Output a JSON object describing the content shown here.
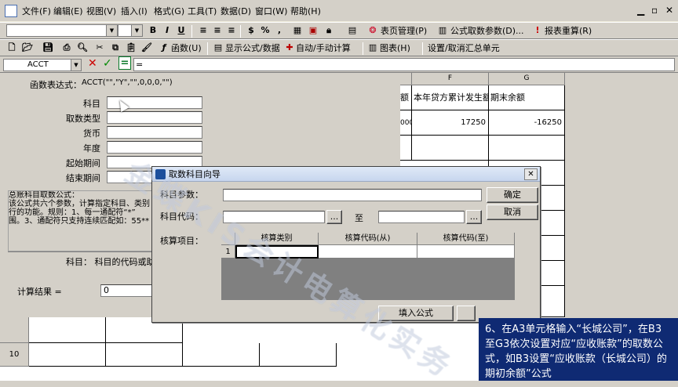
{
  "menu": {
    "items": [
      "文件(F)",
      "编辑(E)",
      "视图(V)",
      "插入(I)",
      "格式(G)",
      "工具(T)",
      "数据(D)",
      "窗口(W)",
      "帮助(H)"
    ],
    "window_controls": [
      "▁",
      "▫",
      "✕"
    ]
  },
  "toolbar1": {
    "font_name": "",
    "font_size": "",
    "bold": "B",
    "italic": "I",
    "underline": "U",
    "percent": "%",
    "comma": ",",
    "sheet_mgmt": "表页管理(P)",
    "fetch_params": "公式取数参数(D)...",
    "recalc": "报表重算(R)"
  },
  "toolbar2": {
    "func": "函数(U)",
    "show_formula": "显示公式/数据",
    "auto_calc": "自动/手动计算",
    "chart": "图表(H)",
    "set_cancel": "设置/取消汇总单元"
  },
  "formula_bar": {
    "name_box": "ACCT",
    "cancel": "✕",
    "confirm": "✓",
    "equals": "=",
    "content": "="
  },
  "spreadsheet": {
    "col_f": "F",
    "col_g": "G",
    "header_e_partial": "额",
    "header_f": "本年贷方累计发生额",
    "header_g": "期末余额",
    "val_e_partial": "000",
    "val_f": "17250",
    "val_g": "-16250",
    "row10": "10"
  },
  "func_panel": {
    "expr_label": "函数表达式：",
    "expr_value": "ACCT(\"\",\"Y\",\"\",0,0,0,\"\")",
    "labels": [
      "科目",
      "取数类型",
      "货币",
      "年度",
      "起始期间",
      "结束期间"
    ],
    "desc_lines": [
      "总账科目取数公式：",
      "该公式共六个参数，计算指定科目、类别",
      "行的功能。规则：1、每一通配符“*”",
      "围。3、通配符只支持连续匹配如：55**"
    ],
    "subject_hint": "科目：  科目的代码或助记",
    "result_label": "计算结果 =",
    "result_value": "0"
  },
  "dialog": {
    "title": "取数科目向导",
    "subject_param_label": "科目参数：",
    "subject_code_label": "科目代码：",
    "to_label": "至",
    "browse": "...",
    "audit_label": "核算项目：",
    "ok": "确定",
    "cancel": "取消",
    "grid_headers": [
      "核算类别",
      "核算代码(从)",
      "核算代码(至)"
    ],
    "row_num": "1",
    "fill_formula": "填入公式"
  },
  "note": {
    "text": "6、在A3单元格输入“长城公司”，在B3至G3依次设置对应“应收账款”的取数公式，如B3设置“应收账款（长城公司）的期初余额”公式"
  },
  "watermark": "金蝶KIS会计电算化实务"
}
